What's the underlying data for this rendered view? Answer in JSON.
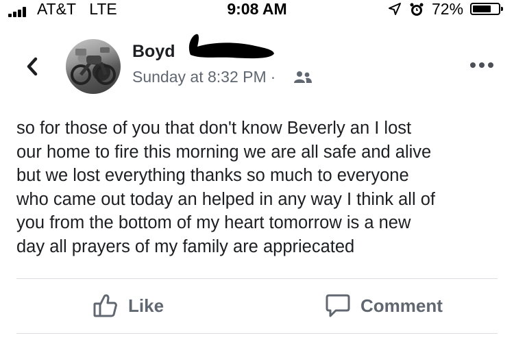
{
  "status_bar": {
    "carrier": "AT&T",
    "network": "LTE",
    "time": "9:08 AM",
    "battery": "72%",
    "battery_level": 0.72,
    "icons": [
      "signal-icon",
      "location-icon",
      "alarm-icon",
      "battery-icon"
    ]
  },
  "post": {
    "author": "Boyd",
    "timestamp": "Sunday at 8:32 PM",
    "separator": "·",
    "audience_icon": "friends-icon",
    "text": "so for those of you that don't know Beverly an I lost\nour home to fire this morning we are all safe and alive\nbut we lost everything thanks so much to everyone\nwho came out today an helped in any way I think all of\nyou from the bottom of my heart  tomorrow is a new\nday all prayers of my family are appriecated"
  },
  "actions": {
    "like_label": "Like",
    "comment_label": "Comment"
  },
  "colors": {
    "text": "#1c1e21",
    "secondary": "#606770",
    "divider": "#dadde1"
  }
}
